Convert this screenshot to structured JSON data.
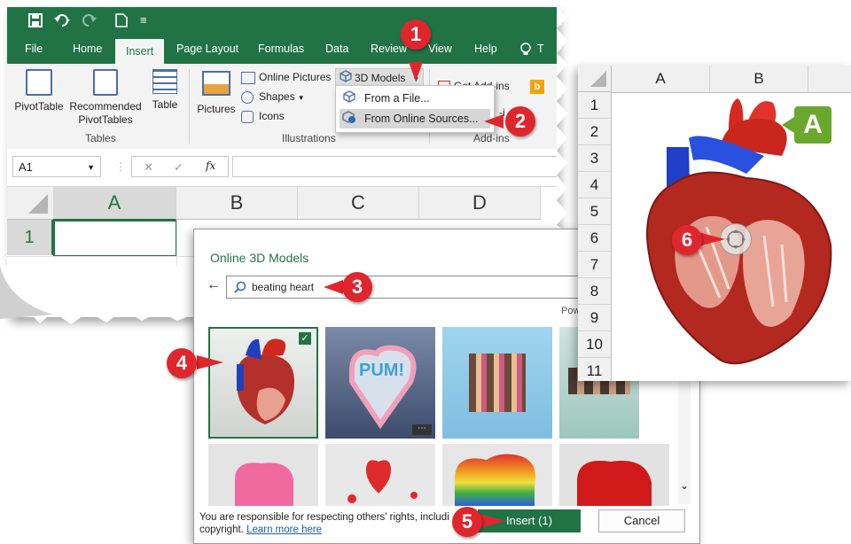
{
  "colors": {
    "excel_green": "#217346",
    "callout_red": "#e0262d",
    "badge_green": "#6aa82d"
  },
  "qat": {
    "save_icon": "save-icon",
    "undo_icon": "undo-icon",
    "redo_icon": "redo-icon",
    "new_icon": "new-doc-icon",
    "more": "≡"
  },
  "tabs": {
    "file": "File",
    "home": "Home",
    "insert": "Insert",
    "page_layout": "Page Layout",
    "formulas": "Formulas",
    "data": "Data",
    "review": "Review",
    "view": "View",
    "help": "Help",
    "tell": "T"
  },
  "ribbon": {
    "pivottable": "PivotTable",
    "recommended_1": "Recommended",
    "recommended_2": "PivotTables",
    "table": "Table",
    "tables_group": "Tables",
    "pictures": "Pictures",
    "online_pictures": "Online Pictures",
    "shapes": "Shapes",
    "icons": "Icons",
    "models_3d": "3D Models",
    "illustrations_group": "Illustrations",
    "get_addins": "Get Add-ins",
    "addins_group": "Add-ins",
    "addins_partial": "-i"
  },
  "dropdown": {
    "from_file": "From a File...",
    "from_online": "From Online Sources..."
  },
  "formula": {
    "namebox": "A1",
    "fx": "fx",
    "cancel": "✕",
    "enter": "✓"
  },
  "grid": {
    "cols": [
      "A",
      "B",
      "C",
      "D"
    ],
    "rows": [
      "1"
    ]
  },
  "dialog": {
    "title": "Online 3D Models",
    "back": "←",
    "search_value": "beating heart",
    "powered": "Pow",
    "footer_line1": "You are responsible for respecting others' rights, includi",
    "footer_line2": "copyright.",
    "learn_more": "Learn more here",
    "insert": "Insert (1)",
    "cancel": "Cancel",
    "thumb_pum": "PUM!",
    "more_dots": "⋯"
  },
  "zoom": {
    "cols": [
      "A",
      "B"
    ],
    "rows": [
      "1",
      "2",
      "3",
      "4",
      "5",
      "6",
      "7",
      "8",
      "9",
      "10",
      "11"
    ],
    "badge": "A"
  },
  "callouts": {
    "c1": "1",
    "c2": "2",
    "c3": "3",
    "c4": "4",
    "c5": "5",
    "c6": "6"
  }
}
